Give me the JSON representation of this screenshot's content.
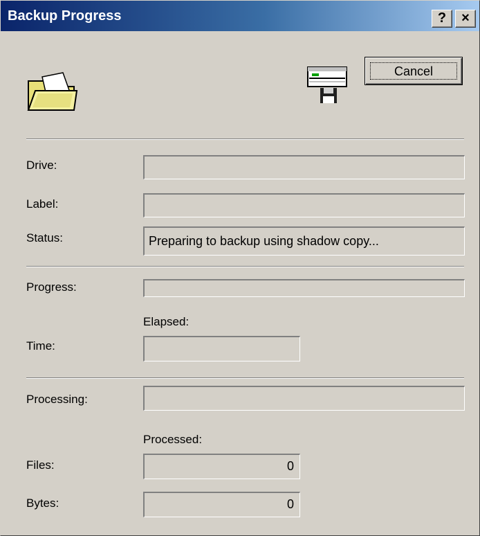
{
  "window": {
    "title": "Backup Progress",
    "help_glyph": "?",
    "close_glyph": "×"
  },
  "icons": {
    "top_left": "folder-icon",
    "top_right": "backup-drive-icon"
  },
  "buttons": {
    "cancel": "Cancel"
  },
  "labels": {
    "drive": "Drive:",
    "label": "Label:",
    "status": "Status:",
    "progress": "Progress:",
    "elapsed": "Elapsed:",
    "time": "Time:",
    "processing": "Processing:",
    "processed": "Processed:",
    "files": "Files:",
    "bytes": "Bytes:"
  },
  "values": {
    "drive": "",
    "label": "",
    "status": "Preparing to backup using shadow copy...",
    "progress_fraction": 0,
    "time_elapsed": "",
    "processing": "",
    "files_processed": "0",
    "bytes_processed": "0"
  }
}
